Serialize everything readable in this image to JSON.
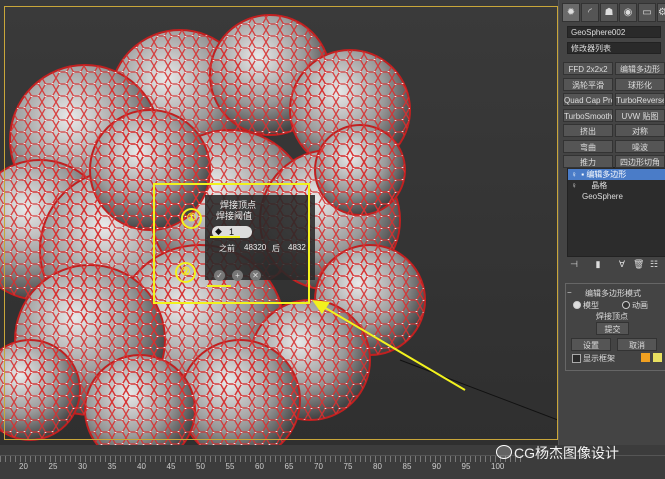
{
  "caddy": {
    "title_1": "焊接顶点",
    "title_2": "焊接阈值",
    "spinner_value": "1",
    "before_label": "之前",
    "before_value": "48320",
    "after_label": "后",
    "after_value": "4832",
    "annotation_1": "①",
    "annotation_2": "②"
  },
  "panel": {
    "object_name": "GeoSphere002",
    "modifier_list": "修改器列表",
    "modifier_buttons": [
      "FFD 2x2x2",
      "编辑多边形",
      "涡轮平滑",
      "球形化",
      "Quad Cap Pro",
      "TurboReverse",
      "TurboSmooth Pro",
      "UVW 贴图",
      "挤出",
      "对称",
      "弯曲",
      "噪波",
      "推力",
      "四边形切角"
    ],
    "stack": [
      "编辑多边形",
      "晶格",
      "GeoSphere"
    ],
    "rollout_title": "编辑多边形模式",
    "mode_model": "模型",
    "mode_anim": "动画",
    "weld_vertex": "焊接顶点",
    "commit": "提交",
    "settings": "设置",
    "cancel": "取消",
    "show_cage": "显示框架",
    "swatch_colors": [
      "#f0a020",
      "#e8e060"
    ]
  },
  "timeline": {
    "ticks": [
      "20",
      "25",
      "30",
      "35",
      "40",
      "45",
      "50",
      "55",
      "60",
      "65",
      "70",
      "75",
      "80",
      "85",
      "90",
      "95",
      "100"
    ]
  },
  "watermark": "CG杨杰图像设计",
  "colors": {
    "accent": "#f2f21e",
    "selected": "#4a7cc8"
  }
}
